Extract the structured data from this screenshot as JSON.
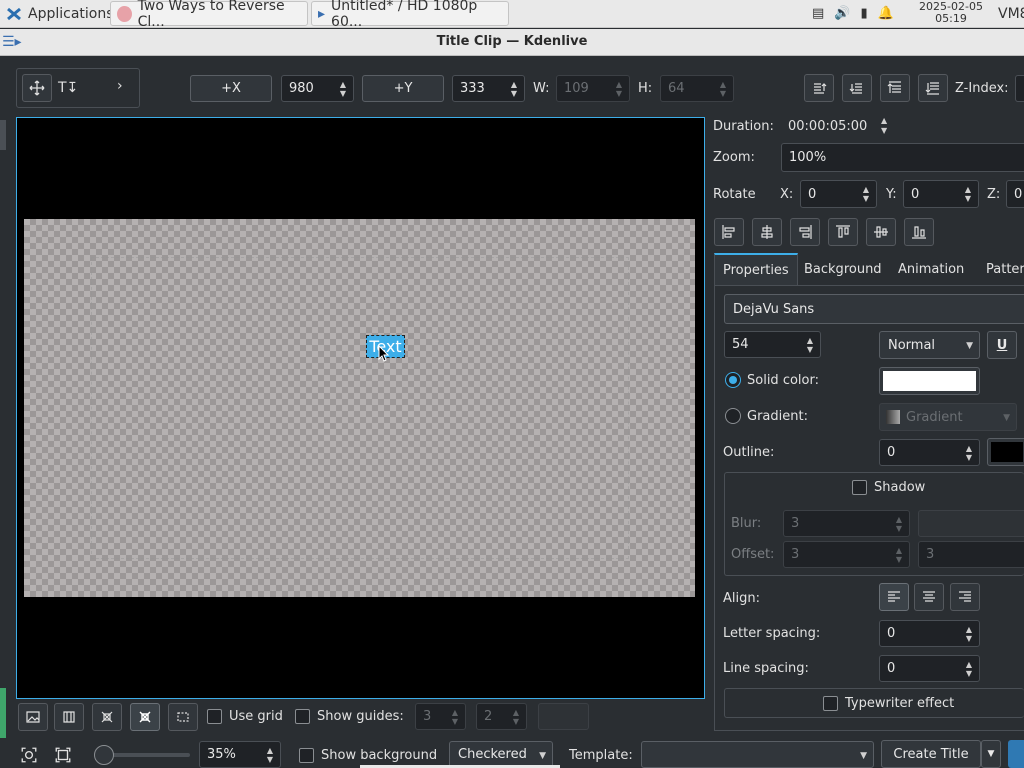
{
  "taskbar": {
    "apps_label": "Applications",
    "win1": "Two Ways to Reverse Cl...",
    "win2": "Untitled* / HD 1080p 60...",
    "date": "2025-02-05",
    "time": "05:19",
    "user": "VM8"
  },
  "window_title": "Title Clip — Kdenlive",
  "toolbar": {
    "x_button": "+X",
    "x_value": "980",
    "y_button": "+Y",
    "y_value": "333",
    "w_label": "W:",
    "w_value": "109",
    "h_label": "H:",
    "h_value": "64",
    "zindex_label": "Z-Index:"
  },
  "canvas": {
    "text_item": "Text"
  },
  "side": {
    "duration_label": "Duration:",
    "duration_value": "00:00:05:00",
    "zoom_label": "Zoom:",
    "zoom_value": "100%",
    "rotate_label": "Rotate",
    "rx_label": "X:",
    "rx_value": "0",
    "ry_label": "Y:",
    "ry_value": "0",
    "rz_label": "Z:",
    "rz_value": "0"
  },
  "tabs": [
    "Properties",
    "Background",
    "Animation",
    "Patter"
  ],
  "props": {
    "font": "DejaVu Sans",
    "size": "54",
    "weight": "Normal",
    "underline": "U",
    "solid_label": "Solid color:",
    "gradient_label": "Gradient:",
    "gradient_value": "Gradient",
    "outline_label": "Outline:",
    "outline_value": "0",
    "shadow_label": "Shadow",
    "blur_label": "Blur:",
    "blur_value": "3",
    "offset_label": "Offset:",
    "offset_x": "3",
    "offset_y": "3",
    "align_label": "Align:",
    "letter_label": "Letter spacing:",
    "letter_value": "0",
    "line_label": "Line spacing:",
    "line_value": "0",
    "typewriter_label": "Typewriter effect"
  },
  "bottom": {
    "use_grid": "Use grid",
    "show_guides": "Show guides:",
    "guides_v": "3",
    "guides_h": "2",
    "zoom_pct": "35%",
    "show_background": "Show background",
    "bg_mode": "Checkered",
    "template_label": "Template:",
    "template_value": "",
    "create_button": "Create Title"
  },
  "colors": {
    "accent": "#3daee9",
    "solid_color": "#ffffff",
    "outline_color": "#000000"
  }
}
